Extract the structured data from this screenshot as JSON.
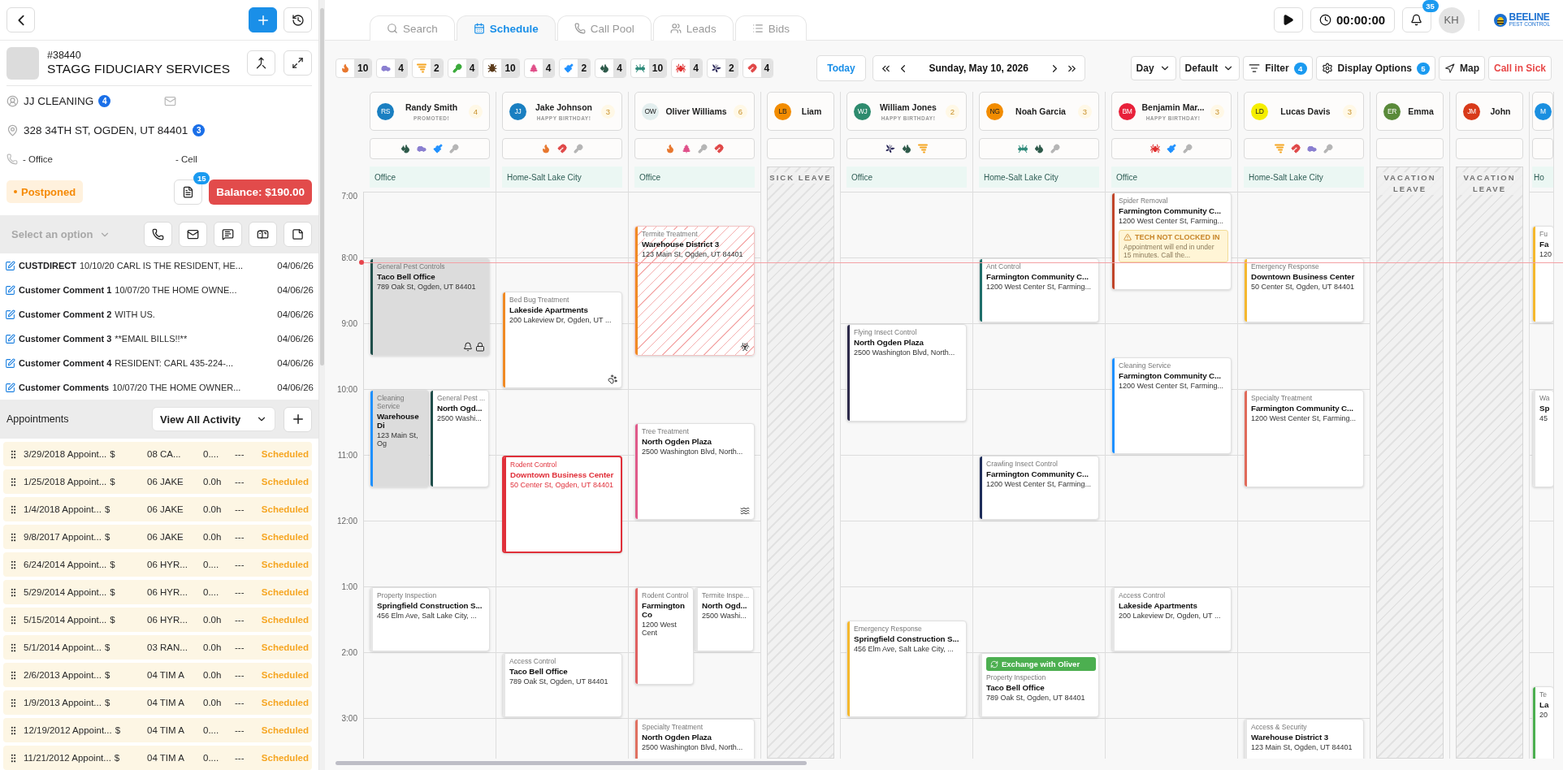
{
  "left_panel": {
    "customer": {
      "number": "#38440",
      "name": "STAGG FIDUCIARY SERVICES",
      "contact": "JJ CLEANING",
      "contact_badge": "4",
      "address": "328 34TH ST, OGDEN, UT 84401",
      "address_badge": "3",
      "phones": [
        "- Office",
        "- Cell"
      ],
      "status": "Postponed",
      "documents_badge": "15",
      "balance": "Balance: $190.00"
    },
    "action_bar": {
      "select_placeholder": "Select an option"
    },
    "comments": [
      {
        "title": "CUSTDIRECT",
        "text": "10/10/20 CARL IS THE RESIDENT, HE...",
        "date": "04/06/26"
      },
      {
        "title": "Customer Comment 1",
        "text": "10/07/20 THE HOME OWNE...",
        "date": "04/06/26"
      },
      {
        "title": "Customer Comment 2",
        "text": "WITH US.",
        "date": "04/06/26"
      },
      {
        "title": "Customer Comment 3",
        "text": "**EMAIL BILLS!!**",
        "date": "04/06/26"
      },
      {
        "title": "Customer Comment 4",
        "text": "RESIDENT: CARL 435-224-...",
        "date": "04/06/26"
      },
      {
        "title": "Customer Comments",
        "text": "10/07/20 THE HOME OWNER...",
        "date": "04/06/26"
      }
    ],
    "appointments": {
      "title": "Appointments",
      "filter": "View All Activity",
      "rows": [
        {
          "title": "3/29/2018 Appoint...",
          "amount": "$",
          "tech": "08 CA...",
          "hours": "0....",
          "notes": "---",
          "status": "Scheduled"
        },
        {
          "title": "1/25/2018 Appoint...",
          "amount": "$",
          "tech": "06 JAKE",
          "hours": "0.0h",
          "notes": "---",
          "status": "Scheduled"
        },
        {
          "title": "1/4/2018 Appoint...",
          "amount": "$",
          "tech": "06 JAKE",
          "hours": "0.0h",
          "notes": "---",
          "status": "Scheduled"
        },
        {
          "title": "9/8/2017 Appoint...",
          "amount": "$",
          "tech": "06 JAKE",
          "hours": "0.0h",
          "notes": "---",
          "status": "Scheduled"
        },
        {
          "title": "6/24/2014 Appoint...",
          "amount": "$",
          "tech": "06 HYR...",
          "hours": "0....",
          "notes": "---",
          "status": "Scheduled"
        },
        {
          "title": "5/29/2014 Appoint...",
          "amount": "$",
          "tech": "06 HYR...",
          "hours": "0....",
          "notes": "---",
          "status": "Scheduled"
        },
        {
          "title": "5/15/2014 Appoint...",
          "amount": "$",
          "tech": "06 HYR...",
          "hours": "0.0h",
          "notes": "---",
          "status": "Scheduled"
        },
        {
          "title": "5/1/2014 Appoint...",
          "amount": "$",
          "tech": "03 RAN...",
          "hours": "0.0h",
          "notes": "---",
          "status": "Scheduled"
        },
        {
          "title": "2/6/2013 Appoint...",
          "amount": "$",
          "tech": "04 TIM A",
          "hours": "0.0h",
          "notes": "---",
          "status": "Scheduled"
        },
        {
          "title": "1/9/2013 Appoint...",
          "amount": "$",
          "tech": "04 TIM A",
          "hours": "0.0h",
          "notes": "---",
          "status": "Scheduled"
        },
        {
          "title": "12/19/2012 Appoint...",
          "amount": "$",
          "tech": "04 TIM A",
          "hours": "0....",
          "notes": "---",
          "status": "Scheduled"
        },
        {
          "title": "11/21/2012 Appoint...",
          "amount": "$",
          "tech": "04 TIM A",
          "hours": "0....",
          "notes": "---",
          "status": "Scheduled"
        }
      ]
    }
  },
  "top_bar": {
    "tabs": [
      {
        "kind": "search",
        "label": "Search",
        "selected": false
      },
      {
        "kind": "calendar",
        "label": "Schedule",
        "selected": true
      },
      {
        "kind": "phone",
        "label": "Call Pool",
        "selected": false
      },
      {
        "kind": "users",
        "label": "Leads",
        "selected": false
      },
      {
        "kind": "list",
        "label": "Bids",
        "selected": false
      }
    ],
    "timer": "00:00:00",
    "notifications": "35",
    "user_initials": "KH",
    "logo": {
      "name": "BEELINE",
      "tagline": "PEST CONTROL"
    }
  },
  "toolbar": {
    "service_counts": [
      {
        "kind": "flame",
        "color": "#e8772e",
        "count": "10"
      },
      {
        "kind": "car",
        "color": "#8a7fd0",
        "count": "4"
      },
      {
        "kind": "tornado",
        "color": "#f5a623",
        "count": "2"
      },
      {
        "kind": "key",
        "color": "#3aaa3a",
        "count": "4"
      },
      {
        "kind": "bug",
        "color": "#5a3a1a",
        "count": "10"
      },
      {
        "kind": "tree",
        "color": "#e0508a",
        "count": "4"
      },
      {
        "kind": "brush",
        "color": "#1e90ff",
        "count": "2"
      },
      {
        "kind": "droplets",
        "color": "#2e5a4a",
        "count": "4"
      },
      {
        "kind": "ant",
        "color": "#2e8a7a",
        "count": "10"
      },
      {
        "kind": "spider",
        "color": "#e03030",
        "count": "4"
      },
      {
        "kind": "butterfly",
        "color": "#2d2a5a",
        "count": "2"
      },
      {
        "kind": "magnet",
        "color": "#e04848",
        "count": "4"
      }
    ],
    "today": "Today",
    "date": "Sunday, May 10, 2026",
    "view": "Day",
    "preset": "Default",
    "filter": {
      "label": "Filter",
      "badge": "4"
    },
    "display_options": {
      "label": "Display Options",
      "badge": "5"
    },
    "map": "Map",
    "call_in_sick": "Call in Sick"
  },
  "schedule": {
    "times": [
      "7:00",
      "8:00",
      "9:00",
      "10:00",
      "11:00",
      "12:00",
      "1:00",
      "2:00",
      "3:00"
    ],
    "technicians": [
      {
        "initials": "RS",
        "name": "Randy Smith",
        "note": "PROMOTED!",
        "count": "4",
        "color": "#1a7fc1",
        "location": "Office",
        "services": [
          {
            "kind": "droplets",
            "color": "#2e5a4a"
          },
          {
            "kind": "car",
            "color": "#8a7fd0"
          },
          {
            "kind": "brush",
            "color": "#1e90ff"
          },
          {
            "kind": "key",
            "color": "#b5b5b5"
          }
        ],
        "appointments": [
          {
            "kind": "completed",
            "type": "General Pest Controls",
            "title": "Taco Bell Office",
            "address": "789 Oak St, Ogden, UT 84401",
            "color": "#1f4e4a",
            "icons": [
              {
                "kind": "bell"
              },
              {
                "kind": "lock"
              }
            ]
          },
          {
            "kind": "completed",
            "type": "Cleaning Service",
            "title": "Warehouse Di",
            "address": "123 Main St, Og",
            "color": "#1e90ff"
          },
          {
            "kind": "standard",
            "type": "General Pest ...",
            "title": "North Ogd...",
            "address": "2500 Washi...",
            "color": "#1f4e4a"
          },
          {
            "kind": "standard",
            "type": "Property Inspection",
            "title": "Springfield Construction S...",
            "address": "456 Elm Ave, Salt Lake City, ...",
            "color": "#e6e6e6"
          }
        ]
      },
      {
        "initials": "JJ",
        "name": "Jake Johnson",
        "note": "HAPPY BIRTHDAY!",
        "count": "3",
        "color": "#1a7fc1",
        "location": "Home-Salt Lake City",
        "services": [
          {
            "kind": "flame",
            "color": "#e8772e"
          },
          {
            "kind": "magnet",
            "color": "#e04848"
          },
          {
            "kind": "key",
            "color": "#b5b5b5"
          }
        ],
        "appointments": [
          {
            "kind": "standard",
            "type": "Bed Bug Treatment",
            "title": "Lakeside Apartments",
            "address": "200 Lakeview Dr, Ogden, UT ...",
            "color": "#f08a24",
            "icons": [
              {
                "kind": "paw"
              }
            ]
          },
          {
            "kind": "urgent",
            "type": "Rodent Control",
            "title": "Downtown Business Center",
            "address": "50 Center St, Ogden, UT 84401",
            "color": "#e0303a"
          },
          {
            "kind": "standard",
            "type": "Access Control",
            "title": "Taco Bell Office",
            "address": "789 Oak St, Ogden, UT 84401",
            "color": "#e6e6e6"
          }
        ]
      },
      {
        "initials": "OW",
        "name": "Oliver Williams",
        "count": "6",
        "color": "#e3eeee",
        "location": "Office",
        "services": [
          {
            "kind": "flame",
            "color": "#e8772e"
          },
          {
            "kind": "tree",
            "color": "#e0508a"
          },
          {
            "kind": "key",
            "color": "#b5b5b5"
          },
          {
            "kind": "magnet",
            "color": "#e04848"
          }
        ],
        "appointments": [
          {
            "kind": "hatched",
            "type": "Termite Treatment",
            "title": "Warehouse District 3",
            "address": "123 Main St, Ogden, UT 84401",
            "color": "#f08a24",
            "icons": [
              {
                "kind": "biohazard"
              }
            ]
          },
          {
            "kind": "standard",
            "type": "Tree Treatment",
            "title": "North Ogden Plaza",
            "address": "2500 Washington Blvd, North...",
            "color": "#e05a8a",
            "icons": [
              {
                "kind": "waves"
              }
            ]
          },
          {
            "kind": "standard",
            "type": "Rodent Control",
            "title": "Farmington Co",
            "address": "1200 West Cent",
            "color": "#e06060"
          },
          {
            "kind": "standard",
            "type": "Termite Inspe...",
            "title": "North Ogd...",
            "address": "2500 Washi...",
            "color": "#e6e6e6"
          },
          {
            "kind": "standard",
            "type": "Specialty Treatment",
            "title": "North Ogden Plaza",
            "address": "2500 Washington Blvd, North...",
            "color": "#e07060"
          }
        ]
      },
      {
        "initials": "LB",
        "name": "Liam",
        "color": "#f28c00",
        "leave": "SICK LEAVE"
      },
      {
        "initials": "WJ",
        "name": "William Jones",
        "note": "HAPPY BIRTHDAY!",
        "count": "2",
        "color": "#2e8b6e",
        "location": "Office",
        "services": [
          {
            "kind": "butterfly",
            "color": "#2d2a5a"
          },
          {
            "kind": "droplets",
            "color": "#2e5a4a"
          },
          {
            "kind": "tornado",
            "color": "#f5a623"
          }
        ],
        "appointments": [
          {
            "kind": "standard",
            "type": "Flying Insect Control",
            "title": "North Ogden Plaza",
            "address": "2500 Washington Blvd, North...",
            "color": "#2d2a4a"
          },
          {
            "kind": "standard",
            "type": "Emergency Response",
            "title": "Springfield Construction S...",
            "address": "456 Elm Ave, Salt Lake City, ...",
            "color": "#f5b82e"
          }
        ]
      },
      {
        "initials": "NG",
        "name": "Noah Garcia",
        "count": "3",
        "color": "#f28c00",
        "location": "Home-Salt Lake City",
        "services": [
          {
            "kind": "ant",
            "color": "#2e8a7a"
          },
          {
            "kind": "droplets",
            "color": "#2e5a4a"
          },
          {
            "kind": "key",
            "color": "#b5b5b5"
          }
        ],
        "appointments": [
          {
            "kind": "standard",
            "type": "Ant Control",
            "title": "Farmington Community C...",
            "address": "1200 West Center St, Farming...",
            "color": "#1f6e6a"
          },
          {
            "kind": "standard",
            "type": "Crawling Insect Control",
            "title": "Farmington Community C...",
            "address": "1200 West Center St, Farming...",
            "color": "#1e2d5a"
          },
          {
            "kind": "standard",
            "type": "Property Inspection",
            "title": "Taco Bell Office",
            "address": "789 Oak St, Ogden, UT 84401",
            "color": "#e6e6e6",
            "exchange": "Exchange with Oliver"
          }
        ]
      },
      {
        "initials": "BM",
        "name": "Benjamin Mar...",
        "note": "HAPPY BIRTHDAY!",
        "count": "3",
        "color": "#e8213a",
        "location": "Office",
        "services": [
          {
            "kind": "spider",
            "color": "#e03030"
          },
          {
            "kind": "brush",
            "color": "#1e90ff"
          },
          {
            "kind": "key",
            "color": "#b5b5b5"
          }
        ],
        "appointments": [
          {
            "kind": "standard",
            "type": "Spider Removal",
            "title": "Farmington Community C...",
            "address": "1200 West Center St, Farming...",
            "color": "#c0452a",
            "warning": {
              "title": "TECH NOT CLOCKED IN",
              "text": "Appointment will end in under 15 minutes. Call the..."
            }
          },
          {
            "kind": "standard",
            "type": "Cleaning Service",
            "title": "Farmington Community C...",
            "address": "1200 West Center St, Farming...",
            "color": "#1e90ff"
          },
          {
            "kind": "standard",
            "type": "Access Control",
            "title": "Lakeside Apartments",
            "address": "200 Lakeview Dr, Ogden, UT ...",
            "color": "#e6e6e6"
          }
        ]
      },
      {
        "initials": "LD",
        "name": "Lucas Davis",
        "count": "3",
        "color": "#f5ee00",
        "location": "Home-Salt Lake City",
        "services": [
          {
            "kind": "tornado",
            "color": "#f5a623"
          },
          {
            "kind": "magnet",
            "color": "#e04848"
          },
          {
            "kind": "car",
            "color": "#8a7fd0"
          },
          {
            "kind": "key",
            "color": "#b5b5b5"
          }
        ],
        "appointments": [
          {
            "kind": "standard",
            "type": "Emergency Response",
            "title": "Downtown Business Center",
            "address": "50 Center St, Ogden, UT 84401",
            "color": "#f5b82e"
          },
          {
            "kind": "standard",
            "type": "Specialty Treatment",
            "title": "Farmington Community C...",
            "address": "1200 West Center St, Farming...",
            "color": "#e06a5a"
          },
          {
            "kind": "standard",
            "type": "Access & Security",
            "title": "Warehouse District 3",
            "address": "123 Main St, Ogden, UT 84401",
            "color": "#e6e6e6"
          }
        ]
      },
      {
        "initials": "ER",
        "name": "Emma",
        "color": "#5a8a3a",
        "leave": "VACATION LEAVE"
      },
      {
        "initials": "JM",
        "name": "John",
        "color": "#d83a1a",
        "leave": "VACATION LEAVE"
      },
      {
        "initials": "M",
        "color": "#1a8fe0",
        "location": "Ho",
        "appointments": [
          {
            "kind": "standard",
            "type": "Fu",
            "title": "Fa",
            "address": "120",
            "color": "#f5b82e"
          },
          {
            "kind": "standard",
            "type": "Wa",
            "title": "Sp",
            "address": "45",
            "color": "#e6e6e6"
          },
          {
            "kind": "standard",
            "type": "Te",
            "title": "La",
            "address": "20",
            "color": "#4caf50"
          }
        ]
      }
    ]
  }
}
